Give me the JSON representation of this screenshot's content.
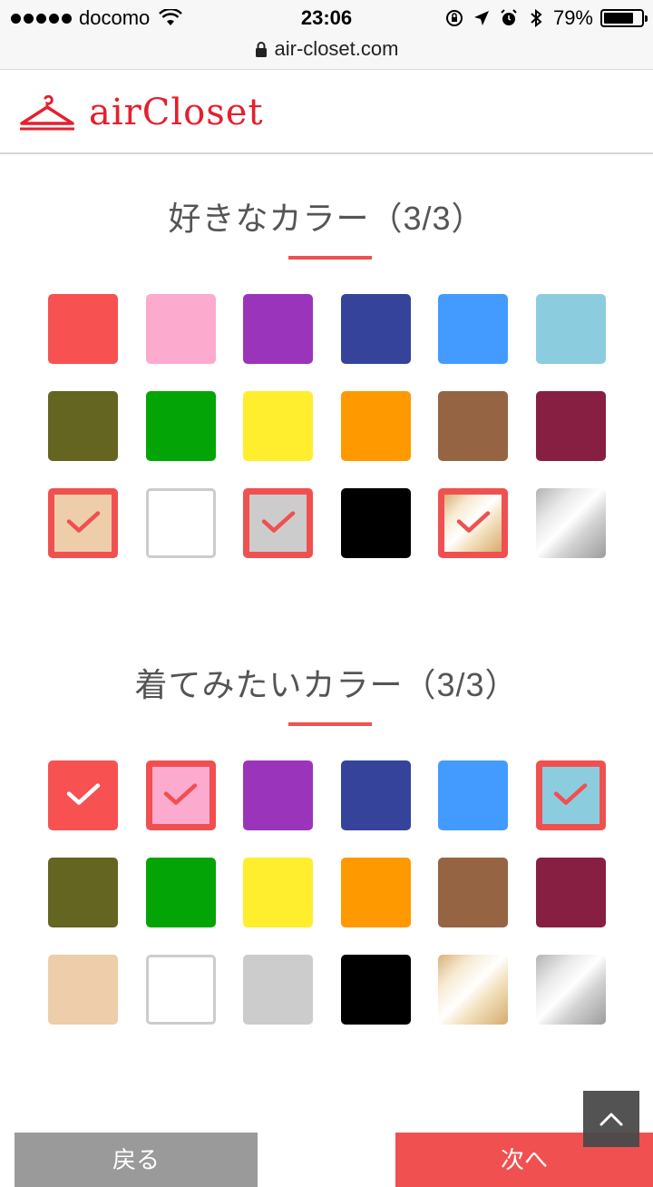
{
  "status_bar": {
    "carrier": "docomo",
    "time": "23:06",
    "battery": "79%",
    "battery_level": 0.79
  },
  "url_bar": {
    "url": "air-closet.com"
  },
  "brand": {
    "logo_text": "airCloset",
    "color": "#e5202e"
  },
  "sections": [
    {
      "title": "好きなカラー（3/3）",
      "swatches": [
        {
          "color": "#f75151",
          "selected": false
        },
        {
          "color": "#fdaacf",
          "selected": false
        },
        {
          "color": "#9a35bb",
          "selected": false
        },
        {
          "color": "#35449a",
          "selected": false
        },
        {
          "color": "#449bff",
          "selected": false
        },
        {
          "color": "#8bcddf",
          "selected": false
        },
        {
          "color": "#636521",
          "selected": false
        },
        {
          "color": "#03a506",
          "selected": false
        },
        {
          "color": "#ffee2e",
          "selected": false
        },
        {
          "color": "#ff9900",
          "selected": false
        },
        {
          "color": "#956443",
          "selected": false
        },
        {
          "color": "#871f43",
          "selected": false
        },
        {
          "color": "#eecdaa",
          "selected": true
        },
        {
          "color": "white",
          "selected": false
        },
        {
          "color": "#cccccc",
          "selected": true
        },
        {
          "color": "#000000",
          "selected": false
        },
        {
          "color": "gold",
          "selected": true
        },
        {
          "color": "silver",
          "selected": false
        }
      ]
    },
    {
      "title": "着てみたいカラー（3/3）",
      "swatches": [
        {
          "color": "#f75151",
          "selected": true
        },
        {
          "color": "#fdaacf",
          "selected": true
        },
        {
          "color": "#9a35bb",
          "selected": false
        },
        {
          "color": "#35449a",
          "selected": false
        },
        {
          "color": "#449bff",
          "selected": false
        },
        {
          "color": "#8bcddf",
          "selected": true
        },
        {
          "color": "#636521",
          "selected": false
        },
        {
          "color": "#03a506",
          "selected": false
        },
        {
          "color": "#ffee2e",
          "selected": false
        },
        {
          "color": "#ff9900",
          "selected": false
        },
        {
          "color": "#956443",
          "selected": false
        },
        {
          "color": "#871f43",
          "selected": false
        },
        {
          "color": "#eecdaa",
          "selected": false
        },
        {
          "color": "white",
          "selected": false
        },
        {
          "color": "#cccccc",
          "selected": false
        },
        {
          "color": "#000000",
          "selected": false
        },
        {
          "color": "gold",
          "selected": false
        },
        {
          "color": "silver",
          "selected": false
        }
      ]
    }
  ],
  "buttons": {
    "back": "戻る",
    "next": "次へ"
  },
  "accent_color": "#f05050",
  "icons": {
    "scroll_top": "chevron-up-icon",
    "hanger": "hanger-icon"
  }
}
